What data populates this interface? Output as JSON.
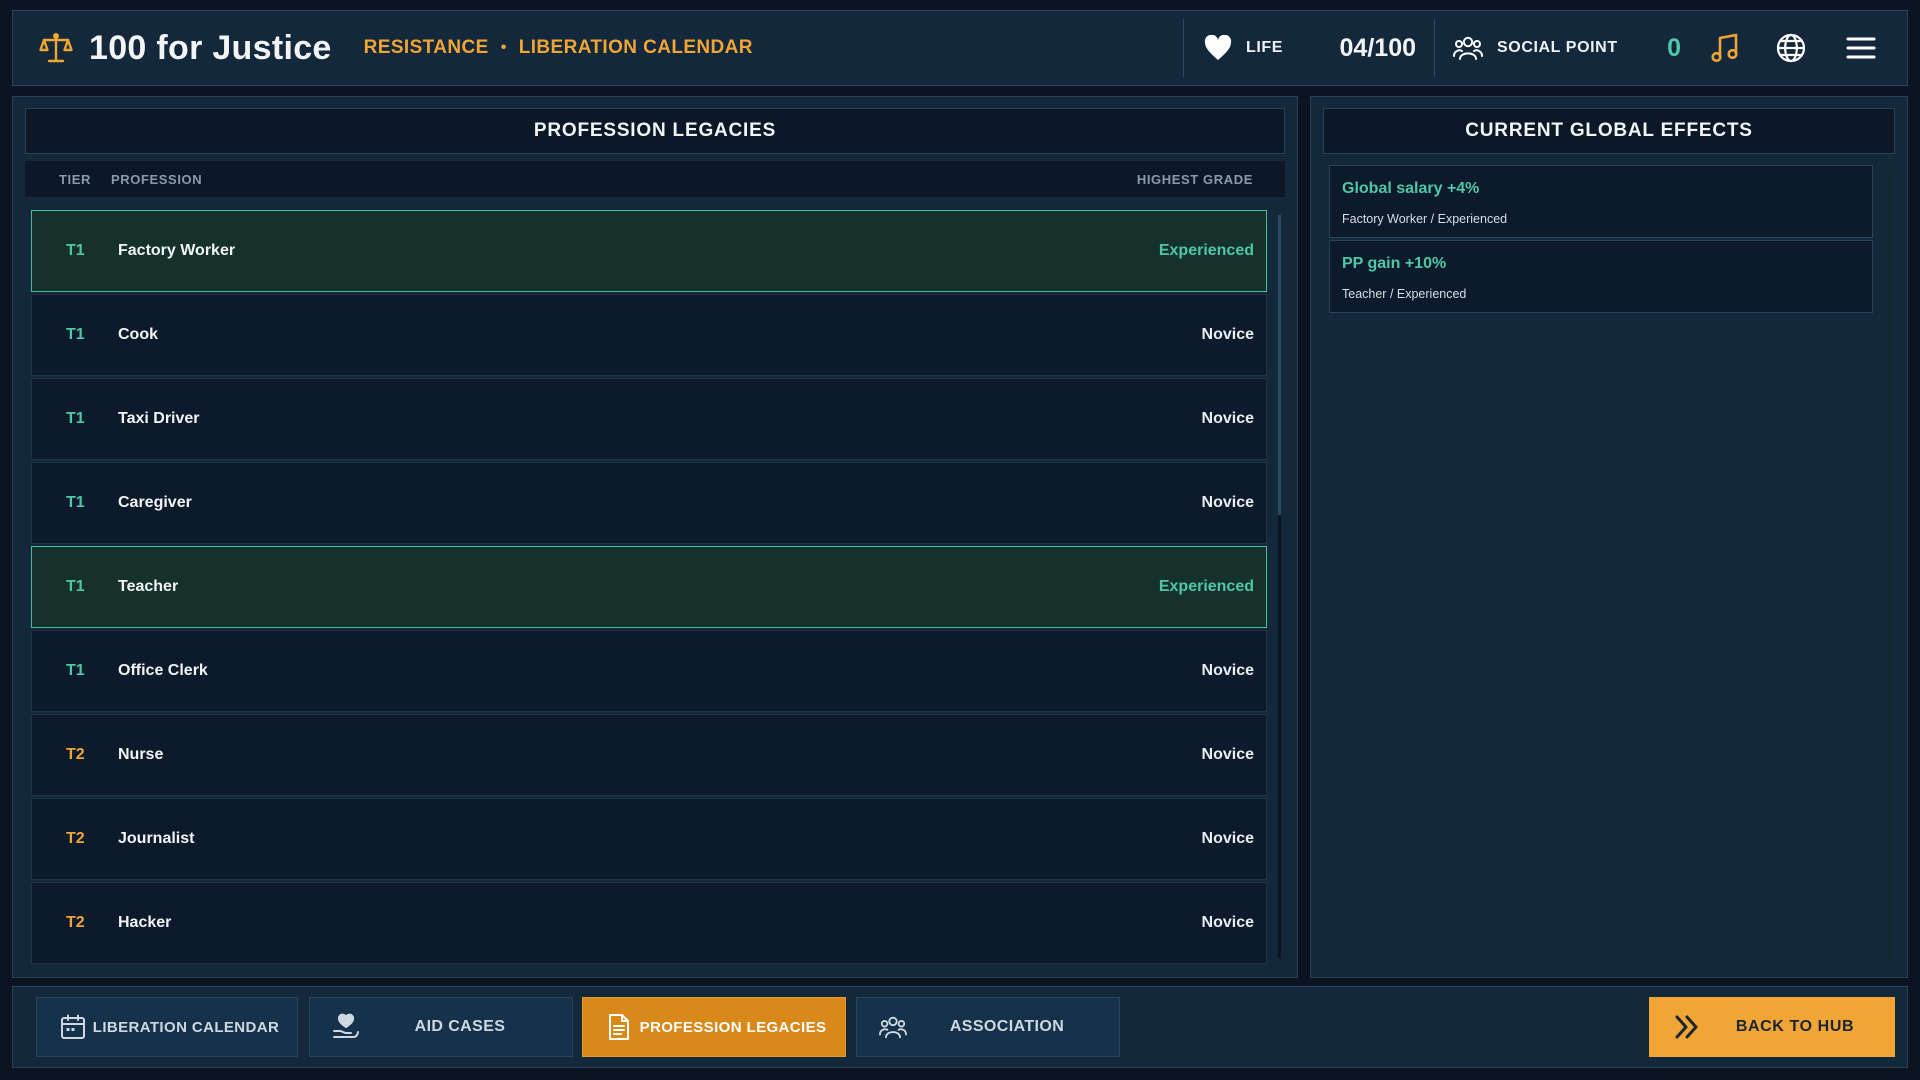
{
  "colors": {
    "accent_orange": "#f0a535",
    "accent_green": "#4fc7a6",
    "tier1": "#4fc7a6",
    "tier2": "#f0a535",
    "grade_experienced": "#4fc7a6",
    "grade_novice": "#e8edf2"
  },
  "header": {
    "logo_icon": "scales-of-justice-icon",
    "title": "100 for Justice",
    "breadcrumb": [
      "RESISTANCE",
      "LIBERATION CALENDAR"
    ],
    "breadcrumb_separator": "•",
    "life": {
      "icon": "heart-icon",
      "label": "LIFE",
      "value": "04/100"
    },
    "social": {
      "icon": "people-icon",
      "label": "SOCIAL POINT",
      "value": "0"
    },
    "buttons": [
      "music-note-icon",
      "globe-icon",
      "hamburger-menu-icon"
    ]
  },
  "legacies": {
    "title": "PROFESSION LEGACIES",
    "columns": {
      "tier": "TIER",
      "profession": "PROFESSION",
      "grade": "HIGHEST GRADE"
    },
    "rows": [
      {
        "tier": "T1",
        "profession": "Factory Worker",
        "grade": "Experienced",
        "highlighted": true
      },
      {
        "tier": "T1",
        "profession": "Cook",
        "grade": "Novice",
        "highlighted": false
      },
      {
        "tier": "T1",
        "profession": "Taxi Driver",
        "grade": "Novice",
        "highlighted": false
      },
      {
        "tier": "T1",
        "profession": "Caregiver",
        "grade": "Novice",
        "highlighted": false
      },
      {
        "tier": "T1",
        "profession": "Teacher",
        "grade": "Experienced",
        "highlighted": true
      },
      {
        "tier": "T1",
        "profession": "Office Clerk",
        "grade": "Novice",
        "highlighted": false
      },
      {
        "tier": "T2",
        "profession": "Nurse",
        "grade": "Novice",
        "highlighted": false
      },
      {
        "tier": "T2",
        "profession": "Journalist",
        "grade": "Novice",
        "highlighted": false
      },
      {
        "tier": "T2",
        "profession": "Hacker",
        "grade": "Novice",
        "highlighted": false
      }
    ]
  },
  "effects": {
    "title": "CURRENT GLOBAL EFFECTS",
    "items": [
      {
        "name": "Global salary +4%",
        "source": "Factory Worker / Experienced"
      },
      {
        "name": "PP gain +10%",
        "source": "Teacher / Experienced"
      }
    ]
  },
  "nav": {
    "tabs": [
      {
        "label": "LIBERATION CALENDAR",
        "icon": "calendar-icon",
        "active": false
      },
      {
        "label": "AID CASES",
        "icon": "heart-hand-icon",
        "active": false
      },
      {
        "label": "PROFESSION LEGACIES",
        "icon": "document-icon",
        "active": true
      },
      {
        "label": "ASSOCIATION",
        "icon": "group-icon",
        "active": false
      }
    ],
    "back": {
      "label": "BACK TO HUB",
      "icon": "double-chevron-right-icon"
    }
  }
}
